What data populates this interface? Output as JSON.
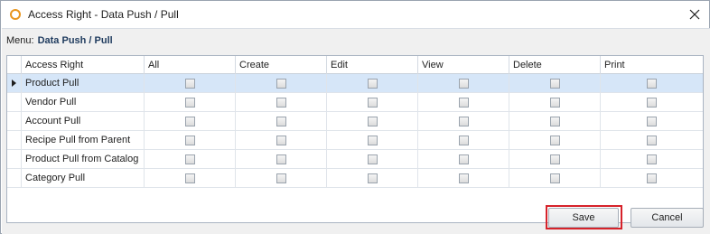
{
  "window": {
    "title": "Access Right - Data Push / Pull",
    "close_icon": "close-icon",
    "app_icon": "circle-app-icon"
  },
  "menu": {
    "label": "Menu:",
    "value": "Data Push / Pull"
  },
  "grid": {
    "columns": [
      "Access Right",
      "All",
      "Create",
      "Edit",
      "View",
      "Delete",
      "Print"
    ],
    "selected_row": 0,
    "rows": [
      {
        "name": "Product Pull",
        "all": false,
        "create": false,
        "edit": false,
        "view": false,
        "delete": false,
        "print": false
      },
      {
        "name": "Vendor Pull",
        "all": false,
        "create": false,
        "edit": false,
        "view": false,
        "delete": false,
        "print": false
      },
      {
        "name": "Account Pull",
        "all": false,
        "create": false,
        "edit": false,
        "view": false,
        "delete": false,
        "print": false
      },
      {
        "name": "Recipe Pull from Parent",
        "all": false,
        "create": false,
        "edit": false,
        "view": false,
        "delete": false,
        "print": false
      },
      {
        "name": "Product Pull from Catalog",
        "all": false,
        "create": false,
        "edit": false,
        "view": false,
        "delete": false,
        "print": false
      },
      {
        "name": "Category Pull",
        "all": false,
        "create": false,
        "edit": false,
        "view": false,
        "delete": false,
        "print": false
      }
    ]
  },
  "buttons": {
    "save_label": "Save",
    "cancel_label": "Cancel"
  },
  "colors": {
    "app_icon": "#e8951e",
    "selected_row": "#d6e6f8",
    "highlight": "#d6222a",
    "menu_value": "#1f3b5e"
  }
}
